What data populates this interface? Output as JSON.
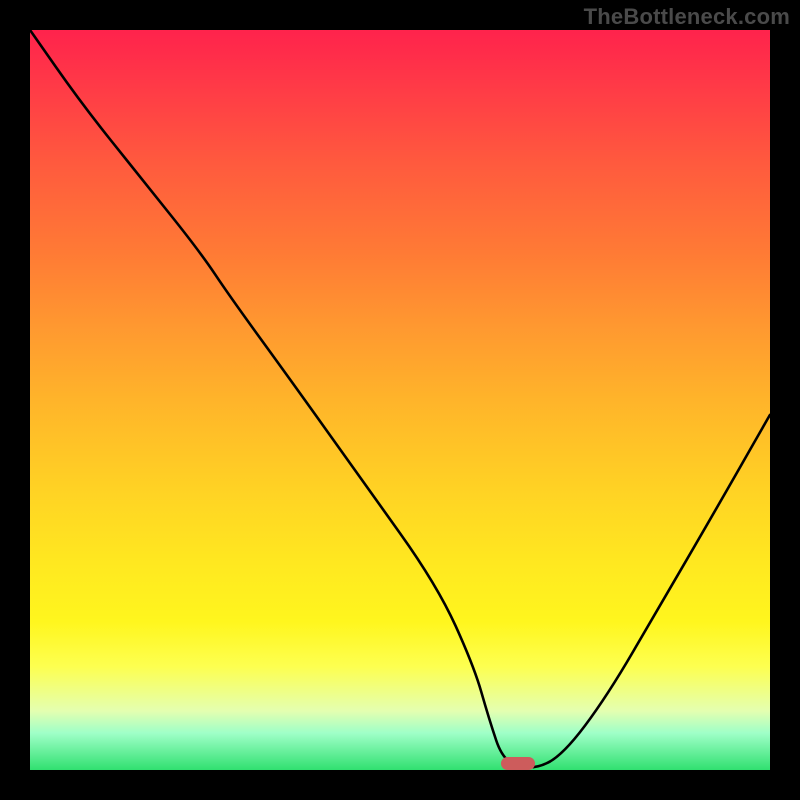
{
  "watermark": "TheBottleneck.com",
  "colors": {
    "frame_bg": "#000000",
    "marker": "#cd5c5c",
    "curve": "#000000",
    "watermark": "#4a4a4a"
  },
  "chart_data": {
    "type": "line",
    "title": "",
    "xlabel": "",
    "ylabel": "",
    "xlim": [
      0,
      100
    ],
    "ylim": [
      0,
      100
    ],
    "grid": false,
    "legend": false,
    "background_gradient": {
      "top": "#ff234c",
      "bottom": "#30e070",
      "note": "continuous vertical rainbow-ish gradient from red (top) through orange, yellow, to green (bottom)"
    },
    "marker": {
      "x": 66,
      "y": 0,
      "shape": "rounded-rect",
      "color": "#cd5c5c",
      "approx_width_pct": 4.6,
      "approx_height_pct": 1.8
    },
    "series": [
      {
        "name": "curve",
        "x": [
          0,
          7,
          15,
          23,
          27,
          35,
          45,
          55,
          60,
          62,
          64,
          68,
          72,
          78,
          85,
          92,
          100
        ],
        "values": [
          100,
          90,
          80,
          70,
          64,
          53,
          39,
          25,
          14,
          7,
          1,
          0,
          2,
          10,
          22,
          34,
          48
        ]
      }
    ],
    "notes": "V-shaped black curve: steep descent from top-left with a slight convex bend ~25% then near-linear fall to a minimum around x≈66%, flat at the bottom for a short span, then rises roughly linearly to ~48% at the right edge."
  }
}
